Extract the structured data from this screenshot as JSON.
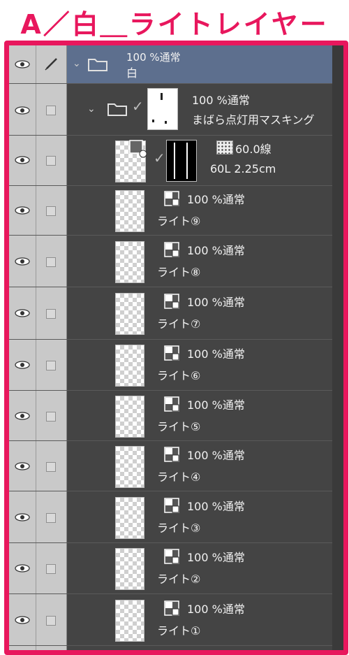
{
  "page_title": "A／白＿ライトレイヤー",
  "folder_main": {
    "opacity_mode": "100 %通常",
    "name": "白"
  },
  "folder_mask": {
    "opacity_mode": "100 %通常",
    "name": "まばら点灯用マスキング"
  },
  "tone_layer": {
    "line": "60.0線",
    "detail": "60L 2.25cm"
  },
  "light_layers": [
    {
      "opacity_mode": "100 %通常",
      "name": "ライト⑨"
    },
    {
      "opacity_mode": "100 %通常",
      "name": "ライト⑧"
    },
    {
      "opacity_mode": "100 %通常",
      "name": "ライト⑦"
    },
    {
      "opacity_mode": "100 %通常",
      "name": "ライト⑥"
    },
    {
      "opacity_mode": "100 %通常",
      "name": "ライト⑤"
    },
    {
      "opacity_mode": "100 %通常",
      "name": "ライト④"
    },
    {
      "opacity_mode": "100 %通常",
      "name": "ライト③"
    },
    {
      "opacity_mode": "100 %通常",
      "name": "ライト②"
    },
    {
      "opacity_mode": "100 %通常",
      "name": "ライト①"
    }
  ],
  "colors": {
    "frame": "#e8175d",
    "selected_row": "#5d6f8e",
    "panel": "#444444"
  }
}
